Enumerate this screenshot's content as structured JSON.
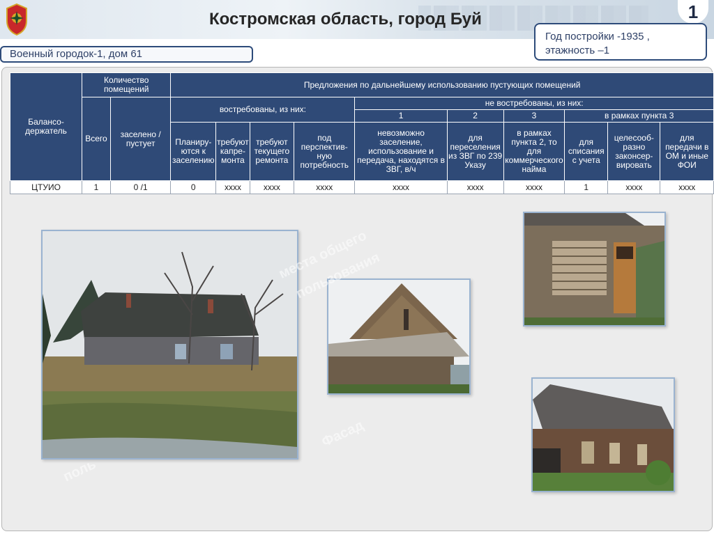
{
  "header": {
    "title": "Костромская область, город Буй",
    "page_number": "1"
  },
  "info": {
    "line1": "Год постройки -1935 ,",
    "line2": "этажность –1"
  },
  "subtitle": "Военный городок-1, дом 61",
  "table": {
    "col_balance": "Балансо-держатель",
    "col_rooms_group": "Количество помещений",
    "col_total": "Всего",
    "col_occupied": "заселено / пустует",
    "col_proposals": "Предложения по дальнейшему использованию пустующих помещений",
    "col_in_demand": "востребованы, из них:",
    "col_not_in_demand": "не востребованы, из них:",
    "num_1": "1",
    "num_2": "2",
    "num_3": "3",
    "col_within_3": "в рамках пункта 3",
    "sub_planned": "Планиру-ются к заселению",
    "sub_capital": "требуют капре-монта",
    "sub_current": "требуют текущего ремонта",
    "sub_future": "под перспектив-ную потребность",
    "sub_impossible": "невозможно заселение, использование и передача, находятся в ЗВГ, в/ч",
    "sub_resettle": "для переселения из ЗВГ по 239 Указу",
    "sub_commercial": "в рамках пункта 2, то для коммерческого найма",
    "sub_writeoff": "для списания с учета",
    "sub_conserve": "целесооб-разно законсер-вировать",
    "sub_transfer": "для передачи в ОМ и иные ФОИ",
    "row": {
      "holder": "ЦТУИО",
      "total": "1",
      "occupied": "0 /1",
      "planned": "0",
      "capital": "хххх",
      "current": "хххх",
      "future": "хххх",
      "impossible": "хххх",
      "resettle": "хххх",
      "commercial": "хххх",
      "writeoff": "1",
      "conserve": "хххх",
      "transfer": "хххх"
    }
  },
  "watermarks": {
    "w1": "места общего",
    "w2": "пользования",
    "w3": "Фасад",
    "w4": "поль"
  }
}
